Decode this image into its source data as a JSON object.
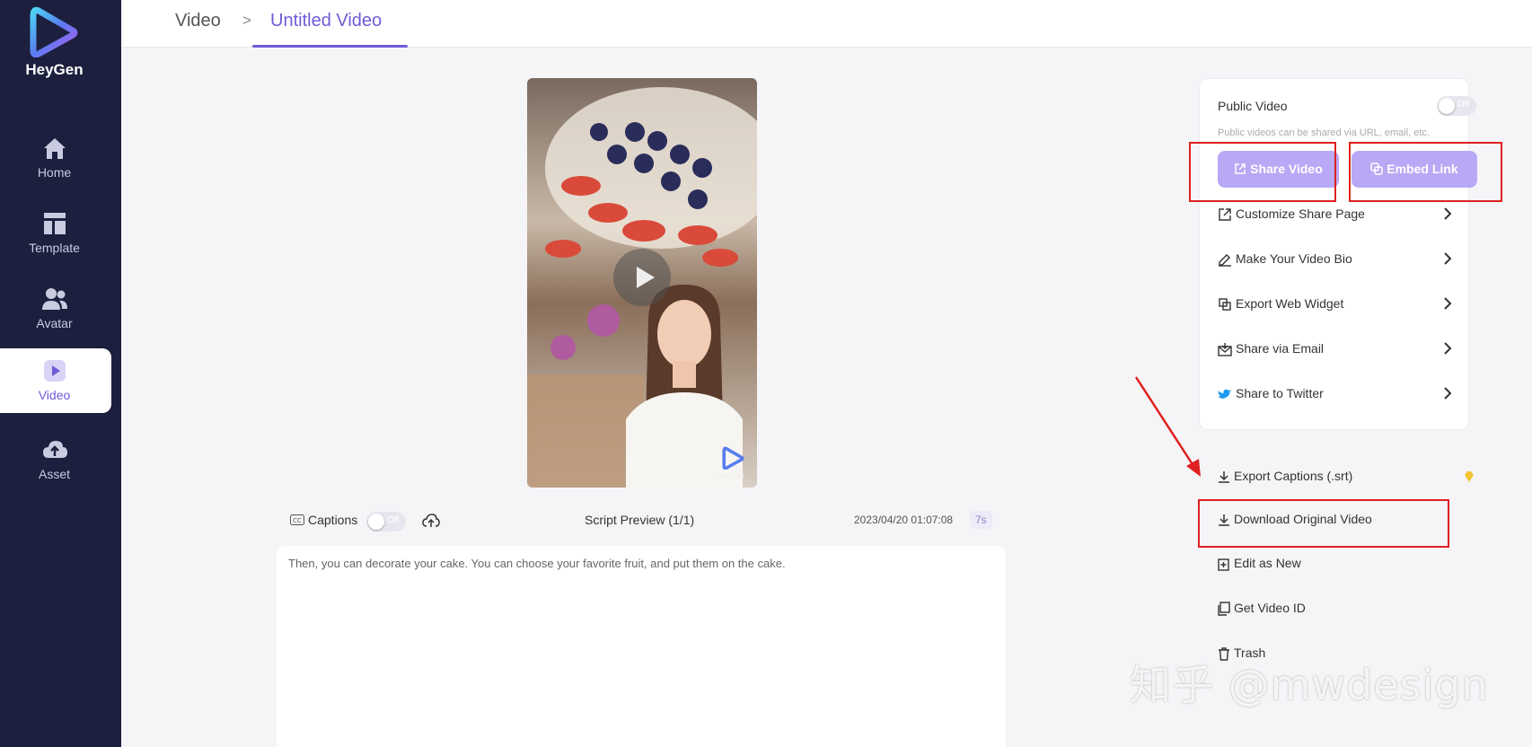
{
  "brand": {
    "name": "HeyGen"
  },
  "sidebar": {
    "items": [
      {
        "label": "Home",
        "icon": "home-icon"
      },
      {
        "label": "Template",
        "icon": "template-icon"
      },
      {
        "label": "Avatar",
        "icon": "avatar-icon"
      },
      {
        "label": "Video",
        "icon": "video-icon",
        "active": true
      },
      {
        "label": "Asset",
        "icon": "upload-cloud-icon"
      }
    ]
  },
  "breadcrumb": {
    "parent": "Video",
    "separator": ">",
    "current": "Untitled Video"
  },
  "player": {
    "captions_label": "Captions",
    "captions_toggle": "Off",
    "script_preview": "Script Preview (1/1)",
    "timestamp": "2023/04/20 01:07:08",
    "duration": "7s",
    "avatar_watermark": "HeyGen"
  },
  "script": {
    "text": "Then, you can decorate your cake. You can choose your favorite fruit, and put them on the cake."
  },
  "share_panel": {
    "public_video_label": "Public Video",
    "public_toggle": "Off",
    "public_hint": "Public videos can be shared via URL, email, etc.",
    "share_button": "Share Video",
    "embed_button": "Embed Link",
    "options": [
      {
        "label": "Customize Share Page",
        "icon": "external-link-icon"
      },
      {
        "label": "Make Your Video Bio",
        "icon": "signature-icon"
      },
      {
        "label": "Export Web Widget",
        "icon": "widget-icon"
      },
      {
        "label": "Share via Email",
        "icon": "email-icon"
      },
      {
        "label": "Share to Twitter",
        "icon": "twitter-icon"
      }
    ]
  },
  "actions": [
    {
      "label": "Export Captions (.srt)",
      "icon": "download-icon",
      "badge_icon": "gem-icon"
    },
    {
      "label": "Download Original Video",
      "icon": "download-icon"
    },
    {
      "label": "Edit as New",
      "icon": "edit-new-icon"
    },
    {
      "label": "Get Video ID",
      "icon": "copy-icon"
    },
    {
      "label": "Trash",
      "icon": "trash-icon"
    }
  ],
  "watermark": "知乎 @mwdesign",
  "colors": {
    "sidebar_bg": "#1c1f3e",
    "accent": "#6c5cd6",
    "button_purple": "#b9a8f5",
    "annotation_red": "#e02020"
  }
}
